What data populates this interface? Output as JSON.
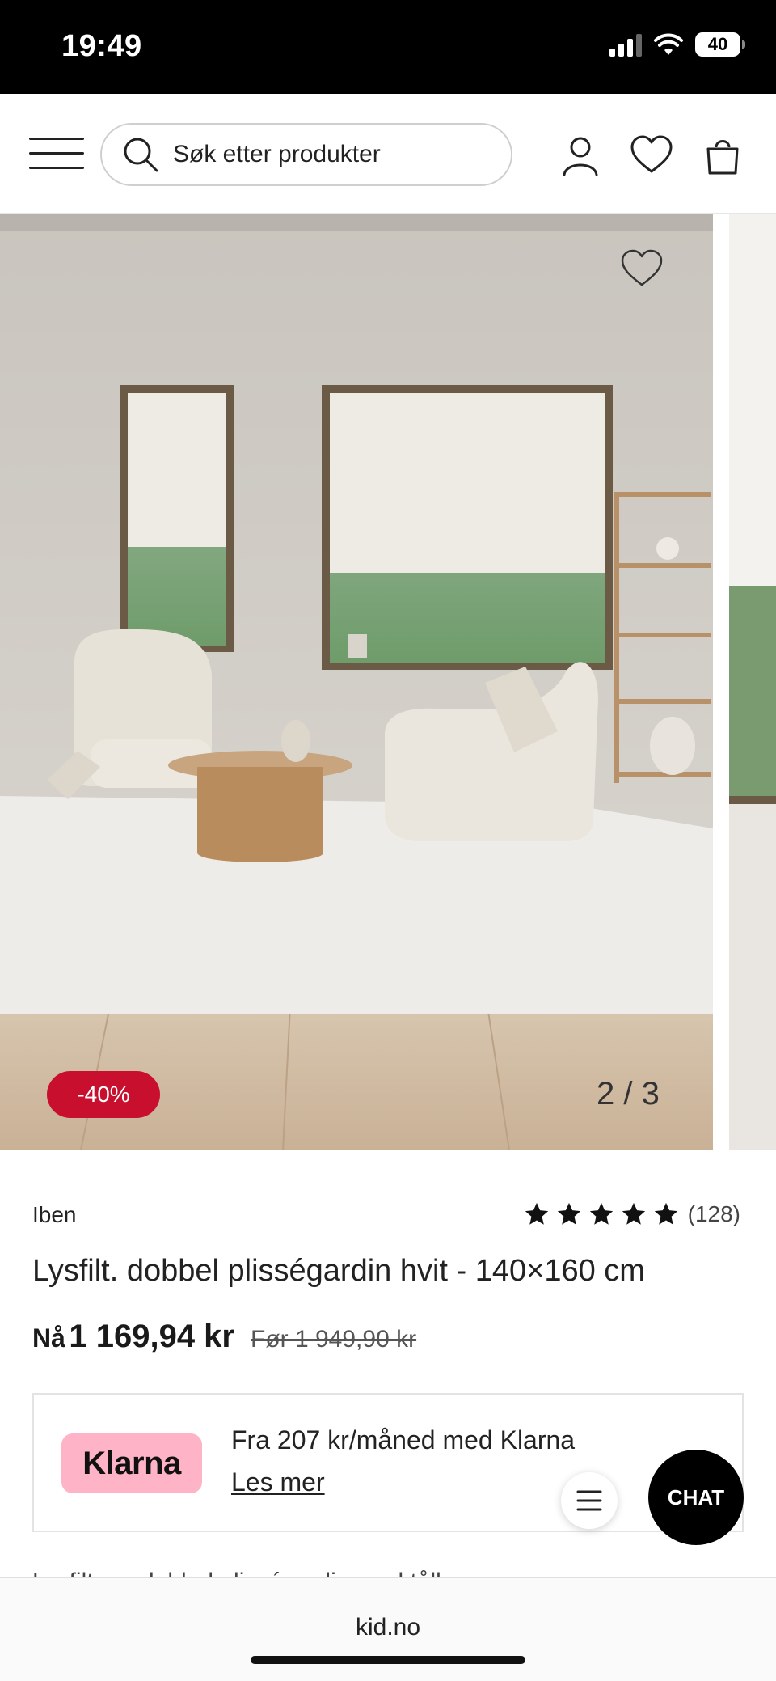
{
  "status_bar": {
    "time": "19:49",
    "battery": "40"
  },
  "header": {
    "search_placeholder": "Søk etter produkter"
  },
  "gallery": {
    "counter": "2 / 3",
    "discount_badge": "-40%"
  },
  "product": {
    "brand": "Iben",
    "rating": 5,
    "review_count": "(128)",
    "title": "Lysfilt. dobbel plisségardin hvit - 140×160 cm",
    "price_now_label": "Nå",
    "price_now": "1 169,94 kr",
    "price_before": "Før 1 949,90 kr"
  },
  "klarna": {
    "logo_text": "Klarna",
    "text": "Fra 207 kr/måned med Klarna",
    "link": "Les mer"
  },
  "chat_button": "CHAT",
  "description_peek": "Lysfilt. og dobbel plisségardin med tåll...",
  "browser": {
    "url": "kid.no"
  },
  "colors": {
    "discount": "#c8102e",
    "klarna_pink": "#ffb3c7",
    "chat_bg": "#000000"
  }
}
